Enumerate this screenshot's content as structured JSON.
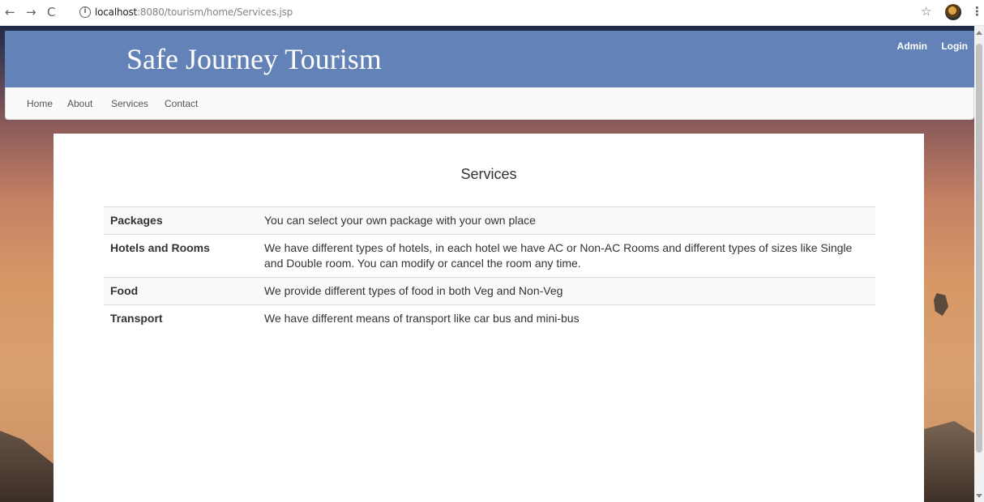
{
  "browser": {
    "back_glyph": "←",
    "forward_glyph": "→",
    "reload_glyph": "C",
    "info_glyph": "i",
    "url_host": "localhost",
    "url_rest": ":8080/tourism/home/Services.jsp",
    "star_glyph": "☆",
    "menu_glyph": "⋮"
  },
  "header": {
    "title": "Safe Journey Tourism",
    "admin_label": "Admin",
    "login_label": "Login",
    "bg_color": "#6383b8"
  },
  "nav": {
    "items": [
      {
        "label": "Home"
      },
      {
        "label": "About"
      },
      {
        "label": "Services"
      },
      {
        "label": "Contact"
      }
    ]
  },
  "main": {
    "title": "Services",
    "services": [
      {
        "name": "Packages",
        "description": "You can select your own package with your own place"
      },
      {
        "name": "Hotels and Rooms",
        "description": "We have different types of hotels, in each hotel we have AC or Non-AC Rooms and different types of sizes like Single and Double room. You can modify or cancel the room any time."
      },
      {
        "name": "Food",
        "description": "We provide different types of food in both Veg and Non-Veg"
      },
      {
        "name": "Transport",
        "description": "We have different means of transport like car bus and mini-bus"
      }
    ]
  }
}
